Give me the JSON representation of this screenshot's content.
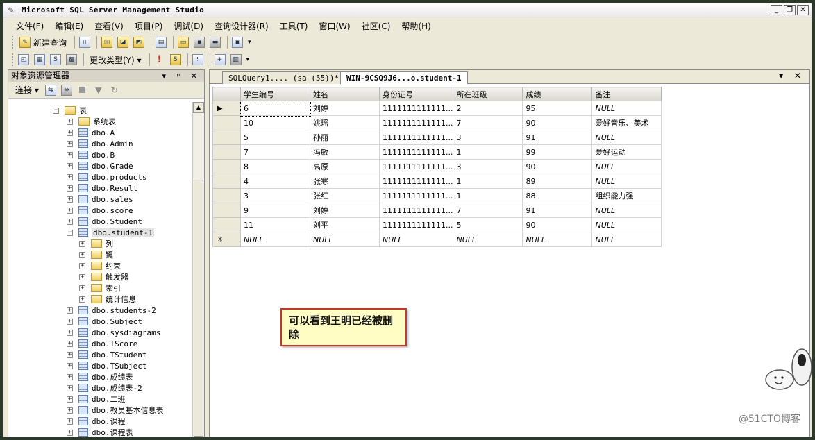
{
  "window": {
    "title": "Microsoft SQL Server Management Studio",
    "controls": [
      "_",
      "❐",
      "✕"
    ]
  },
  "menu": [
    "文件(F)",
    "编辑(E)",
    "查看(V)",
    "项目(P)",
    "调试(D)",
    "查询设计器(R)",
    "工具(T)",
    "窗口(W)",
    "社区(C)",
    "帮助(H)"
  ],
  "toolbar1": {
    "new_query": "新建查询"
  },
  "toolbar2": {
    "change_type": "更改类型(Y) ▾"
  },
  "explorer": {
    "title": "对象资源管理器",
    "title_buttons": "▾ ᵖ ✕",
    "connect": "连接 ▾",
    "tree": [
      {
        "indent": 0,
        "type": "folder",
        "expand": "−",
        "label": "表"
      },
      {
        "indent": 1,
        "type": "folder",
        "expand": "+",
        "label": "系统表"
      },
      {
        "indent": 1,
        "type": "table",
        "expand": "+",
        "label": "dbo.A"
      },
      {
        "indent": 1,
        "type": "table",
        "expand": "+",
        "label": "dbo.Admin"
      },
      {
        "indent": 1,
        "type": "table",
        "expand": "+",
        "label": "dbo.B"
      },
      {
        "indent": 1,
        "type": "table",
        "expand": "+",
        "label": "dbo.Grade"
      },
      {
        "indent": 1,
        "type": "table",
        "expand": "+",
        "label": "dbo.products"
      },
      {
        "indent": 1,
        "type": "table",
        "expand": "+",
        "label": "dbo.Result"
      },
      {
        "indent": 1,
        "type": "table",
        "expand": "+",
        "label": "dbo.sales"
      },
      {
        "indent": 1,
        "type": "table",
        "expand": "+",
        "label": "dbo.score"
      },
      {
        "indent": 1,
        "type": "table",
        "expand": "+",
        "label": "dbo.Student"
      },
      {
        "indent": 1,
        "type": "table",
        "expand": "−",
        "label": "dbo.student-1",
        "selected": true
      },
      {
        "indent": 2,
        "type": "folder",
        "expand": "+",
        "label": "列"
      },
      {
        "indent": 2,
        "type": "folder",
        "expand": "+",
        "label": "键"
      },
      {
        "indent": 2,
        "type": "folder",
        "expand": "+",
        "label": "约束"
      },
      {
        "indent": 2,
        "type": "folder",
        "expand": "+",
        "label": "触发器"
      },
      {
        "indent": 2,
        "type": "folder",
        "expand": "+",
        "label": "索引"
      },
      {
        "indent": 2,
        "type": "folder",
        "expand": "+",
        "label": "统计信息"
      },
      {
        "indent": 1,
        "type": "table",
        "expand": "+",
        "label": "dbo.students-2"
      },
      {
        "indent": 1,
        "type": "table",
        "expand": "+",
        "label": "dbo.Subject"
      },
      {
        "indent": 1,
        "type": "table",
        "expand": "+",
        "label": "dbo.sysdiagrams"
      },
      {
        "indent": 1,
        "type": "table",
        "expand": "+",
        "label": "dbo.TScore"
      },
      {
        "indent": 1,
        "type": "table",
        "expand": "+",
        "label": "dbo.TStudent"
      },
      {
        "indent": 1,
        "type": "table",
        "expand": "+",
        "label": "dbo.TSubject"
      },
      {
        "indent": 1,
        "type": "table",
        "expand": "+",
        "label": "dbo.成绩表"
      },
      {
        "indent": 1,
        "type": "table",
        "expand": "+",
        "label": "dbo.成绩表-2"
      },
      {
        "indent": 1,
        "type": "table",
        "expand": "+",
        "label": "dbo.二班"
      },
      {
        "indent": 1,
        "type": "table",
        "expand": "+",
        "label": "dbo.教员基本信息表"
      },
      {
        "indent": 1,
        "type": "table",
        "expand": "+",
        "label": "dbo.课程"
      },
      {
        "indent": 1,
        "type": "table",
        "expand": "+",
        "label": "dbo.课程表"
      }
    ]
  },
  "tabs": [
    {
      "label": "SQLQuery1.... (sa (55))*",
      "active": false
    },
    {
      "label": "WIN-9CSQ9J6...o.student-1",
      "active": true
    }
  ],
  "tab_controls": "▾ ✕",
  "grid": {
    "columns": [
      "学生编号",
      "姓名",
      "身份证号",
      "所在班级",
      "成绩",
      "备注"
    ],
    "rows": [
      {
        "marker": "▶",
        "cells": [
          "6",
          "刘婷",
          "1111111111111...",
          "2",
          "95",
          "NULL"
        ]
      },
      {
        "marker": "",
        "cells": [
          "10",
          "姚瑶",
          "1111111111111...",
          "7",
          "90",
          "爱好音乐、美术"
        ]
      },
      {
        "marker": "",
        "cells": [
          "5",
          "孙丽",
          "1111111111111...",
          "3",
          "91",
          "NULL"
        ]
      },
      {
        "marker": "",
        "cells": [
          "7",
          "冯敏",
          "1111111111111...",
          "1",
          "99",
          "爱好运动"
        ]
      },
      {
        "marker": "",
        "cells": [
          "8",
          "高原",
          "1111111111111...",
          "3",
          "90",
          "NULL"
        ]
      },
      {
        "marker": "",
        "cells": [
          "4",
          "张寒",
          "1111111111111...",
          "1",
          "89",
          "NULL"
        ]
      },
      {
        "marker": "",
        "cells": [
          "3",
          "张红",
          "1111111111111...",
          "1",
          "88",
          "组织能力强"
        ]
      },
      {
        "marker": "",
        "cells": [
          "9",
          "刘婷",
          "1111111111111...",
          "7",
          "91",
          "NULL"
        ]
      },
      {
        "marker": "",
        "cells": [
          "11",
          "刘平",
          "1111111111111...",
          "5",
          "90",
          "NULL"
        ]
      },
      {
        "marker": "✳",
        "cells": [
          "NULL",
          "NULL",
          "NULL",
          "NULL",
          "NULL",
          "NULL"
        ]
      }
    ]
  },
  "callout": "可以看到王明已经被删除",
  "watermark": "@51CTO博客"
}
